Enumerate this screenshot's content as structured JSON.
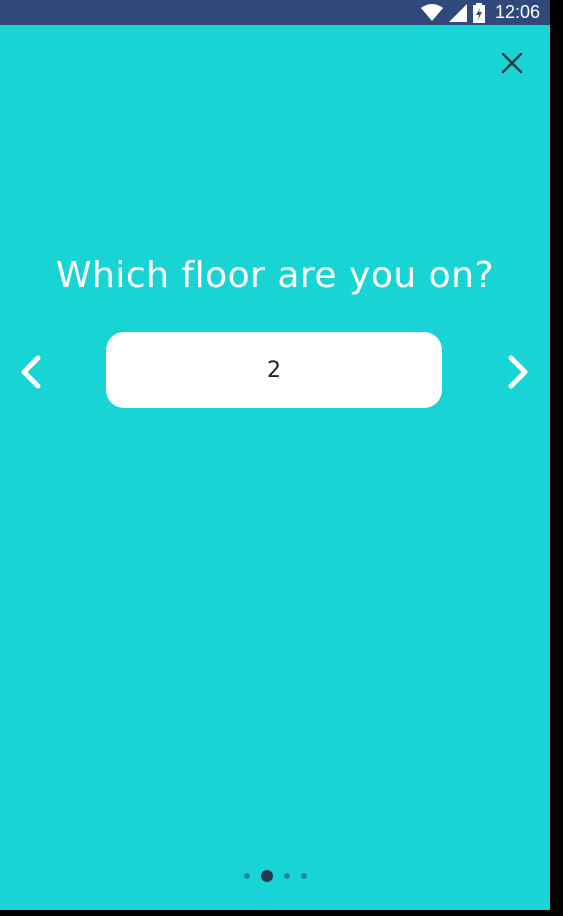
{
  "status_bar": {
    "time": "12:06",
    "icons": [
      "wifi-icon",
      "signal-icon",
      "battery-icon"
    ]
  },
  "onboarding": {
    "question": "Which floor are you on?",
    "floor_value": "2",
    "close_icon": "close-icon",
    "prev_icon": "chevron-left-icon",
    "next_icon": "chevron-right-icon",
    "pager": {
      "total": 4,
      "active_index": 1
    }
  },
  "colors": {
    "background": "#19d4d4",
    "status_bar": "#2f4a7a",
    "input_bg": "#ffffff",
    "dot_inactive": "#1a8f96",
    "dot_active": "#1f3a4a"
  }
}
